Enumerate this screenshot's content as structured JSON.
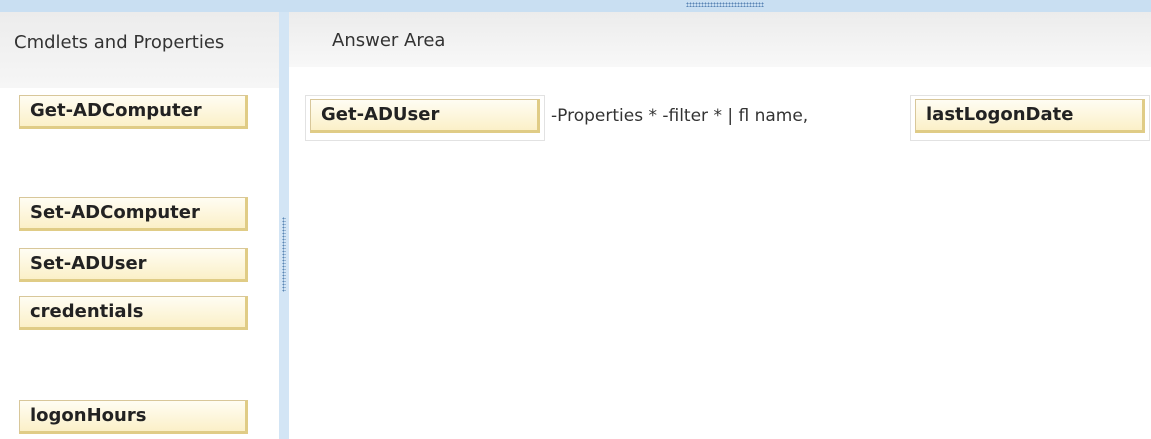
{
  "left_panel": {
    "title": "Cmdlets and Properties",
    "items": [
      {
        "label": "Get-ADComputer"
      },
      {
        "label": "Set-ADComputer"
      },
      {
        "label": "Set-ADUser"
      },
      {
        "label": "credentials"
      },
      {
        "label": "logonHours"
      }
    ]
  },
  "answer_area": {
    "title": "Answer Area",
    "slot1": "Get-ADUser",
    "command_text": "-Properties * -filter * | fl name,",
    "slot2": "lastLogonDate"
  },
  "colors": {
    "tile_fill": "#fbf0c8",
    "tile_border": "#e0cc86",
    "splitter": "#d3e5f5"
  },
  "icons": [
    "splitter-grip",
    "top-grip"
  ]
}
